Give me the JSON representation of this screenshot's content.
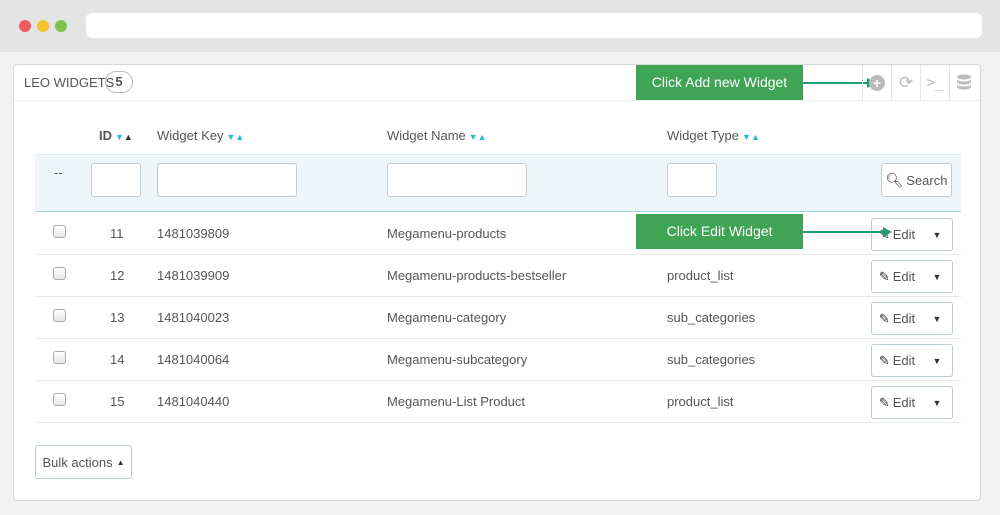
{
  "panel": {
    "title": "LEO WIDGETS",
    "count": "5"
  },
  "toolbar": {
    "add_icon": "plus-circle-icon",
    "refresh_icon": "refresh-icon",
    "sql_icon": "terminal-icon",
    "db_icon": "database-icon"
  },
  "callouts": {
    "add": "Click Add new Widget",
    "edit": "Click Edit Widget"
  },
  "columns": {
    "id": "ID",
    "key": "Widget Key",
    "name": "Widget Name",
    "type": "Widget Type"
  },
  "filters": {
    "placeholder_dash": "--",
    "search_label": "Search"
  },
  "rows": [
    {
      "id": "11",
      "key": "1481039809",
      "name": "Megamenu-products",
      "type": ""
    },
    {
      "id": "12",
      "key": "1481039909",
      "name": "Megamenu-products-bestseller",
      "type": "product_list"
    },
    {
      "id": "13",
      "key": "1481040023",
      "name": "Megamenu-category",
      "type": "sub_categories"
    },
    {
      "id": "14",
      "key": "1481040064",
      "name": "Megamenu-subcategory",
      "type": "sub_categories"
    },
    {
      "id": "15",
      "key": "1481040440",
      "name": "Megamenu-List Product",
      "type": "product_list"
    }
  ],
  "actions": {
    "edit_label": "Edit",
    "bulk_label": "Bulk actions"
  },
  "colors": {
    "accent": "#25b9d7",
    "callout": "#3fa454",
    "arrow": "#1e9e78"
  }
}
